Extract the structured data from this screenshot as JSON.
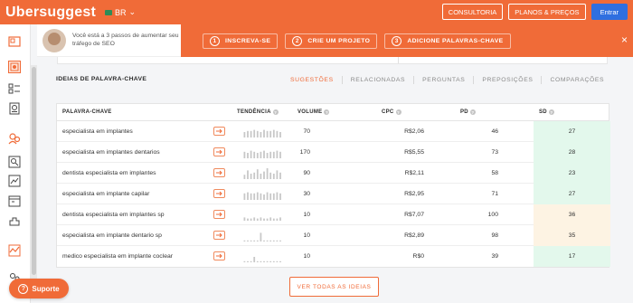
{
  "header": {
    "logo": "Ubersuggest",
    "language": "BR",
    "buttons": [
      "CONSULTORIA",
      "PLANOS & PREÇOS",
      "Entrar"
    ]
  },
  "onboarding": {
    "message": "Você está a 3 passos de aumentar seu tráfego de SEO",
    "steps": [
      {
        "num": "1",
        "label": "INSCREVA-SE"
      },
      {
        "num": "2",
        "label": "CRIE UM PROJETO"
      },
      {
        "num": "3",
        "label": "ADICIONE PALAVRAS-CHAVE"
      }
    ],
    "close": "×"
  },
  "section": {
    "title": "IDEIAS DE PALAVRA-CHAVE",
    "tabs": [
      "SUGESTÕES",
      "RELACIONADAS",
      "PERGUNTAS",
      "PREPOSIÇÕES",
      "COMPARAÇÕES"
    ],
    "active_tab": "SUGESTÕES"
  },
  "table": {
    "headers": {
      "keyword": "PALAVRA-CHAVE",
      "trend": "TENDÊNCIA",
      "volume": "VOLUME",
      "cpc": "CPC",
      "pd": "PD",
      "sd": "SD"
    },
    "rows": [
      {
        "keyword": "especialista em implantes",
        "volume": "70",
        "cpc": "R$2,06",
        "pd": "46",
        "sd": "27",
        "sd_color": "#e3f8ec",
        "trend": [
          5,
          6,
          6,
          7,
          6,
          5,
          7,
          6,
          6,
          7,
          6,
          5
        ]
      },
      {
        "keyword": "especialista em implantes dentarios",
        "volume": "170",
        "cpc": "R$5,55",
        "pd": "73",
        "sd": "28",
        "sd_color": "#e3f8ec",
        "trend": [
          6,
          5,
          7,
          6,
          5,
          6,
          7,
          5,
          6,
          6,
          7,
          6
        ]
      },
      {
        "keyword": "dentista especialista em implantes",
        "volume": "90",
        "cpc": "R$2,11",
        "pd": "58",
        "sd": "23",
        "sd_color": "#e3f8ec",
        "trend": [
          4,
          8,
          5,
          6,
          9,
          5,
          7,
          10,
          6,
          5,
          8,
          6
        ]
      },
      {
        "keyword": "especialista em implante capilar",
        "volume": "30",
        "cpc": "R$2,95",
        "pd": "71",
        "sd": "27",
        "sd_color": "#e3f8ec",
        "trend": [
          6,
          7,
          6,
          6,
          7,
          6,
          5,
          7,
          6,
          6,
          7,
          6
        ]
      },
      {
        "keyword": "dentista especialista em implantes sp",
        "volume": "10",
        "cpc": "R$7,07",
        "pd": "100",
        "sd": "36",
        "sd_color": "#fdf3e3",
        "trend": [
          3,
          2,
          2,
          3,
          2,
          3,
          2,
          2,
          3,
          2,
          2,
          3
        ]
      },
      {
        "keyword": "especialista em implante dentario sp",
        "volume": "10",
        "cpc": "R$2,89",
        "pd": "98",
        "sd": "35",
        "sd_color": "#fdf3e3",
        "trend": [
          1,
          1,
          1,
          1,
          1,
          8,
          1,
          1,
          1,
          1,
          1,
          1
        ]
      },
      {
        "keyword": "medico especialista em implante coclear",
        "volume": "10",
        "cpc": "R$0",
        "pd": "39",
        "sd": "17",
        "sd_color": "#e3f8ec",
        "trend": [
          1,
          1,
          1,
          5,
          1,
          1,
          1,
          1,
          1,
          1,
          1,
          1
        ]
      }
    ]
  },
  "actions": {
    "view_all": "VER TODAS AS IDEIAS",
    "support": "Suporte"
  },
  "colors": {
    "brand": "#f06b38",
    "login": "#2f6fe0",
    "sd_easy": "#e3f8ec",
    "sd_medium": "#fdf3e3"
  },
  "sidebar_icons": [
    "dashboard-icon",
    "keyword-overview-icon",
    "keyword-ideas-icon",
    "content-ideas-icon",
    "competitors-icon",
    "site-audit-icon",
    "rank-tracking-icon",
    "calendar-icon",
    "backlinks-icon",
    "traffic-chart-icon",
    "settings-icon"
  ]
}
